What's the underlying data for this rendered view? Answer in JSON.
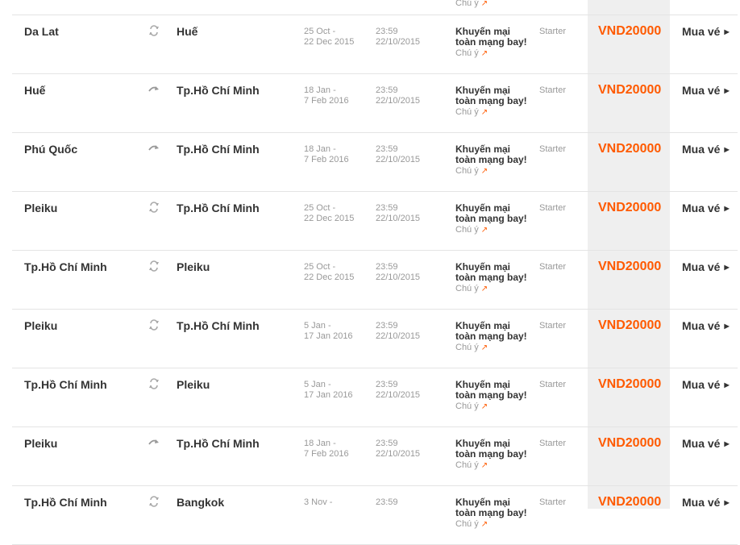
{
  "labels": {
    "note": "Chú ý",
    "buy": "Mua vé",
    "promo": "Khuyến mại toàn mạng bay!",
    "fare_class": "Starter",
    "price": "VND20000"
  },
  "icons": {
    "round_trip": "round-trip-icon",
    "one_way": "one-way-icon",
    "note_arrow": "external-arrow-icon"
  },
  "colors": {
    "accent": "#ff5a00",
    "price_band": "#efefef",
    "muted_text": "#999999",
    "main_text": "#333333"
  },
  "rows": [
    {
      "origin": "Da Lat",
      "dest": "Huế",
      "trip": "round",
      "dates": "25 Oct -\n22 Dec 2015",
      "until": "23:59\n22/10/2015"
    },
    {
      "origin": "Huế",
      "dest": "Tp.Hồ Chí Minh",
      "trip": "oneway",
      "dates": "18 Jan -\n7 Feb 2016",
      "until": "23:59\n22/10/2015"
    },
    {
      "origin": "Phú Quốc",
      "dest": "Tp.Hồ Chí Minh",
      "trip": "oneway",
      "dates": "18 Jan -\n7 Feb 2016",
      "until": "23:59\n22/10/2015"
    },
    {
      "origin": "Pleiku",
      "dest": "Tp.Hồ Chí Minh",
      "trip": "round",
      "dates": "25 Oct -\n22 Dec 2015",
      "until": "23:59\n22/10/2015"
    },
    {
      "origin": "Tp.Hồ Chí Minh",
      "dest": "Pleiku",
      "trip": "round",
      "dates": "25 Oct -\n22 Dec 2015",
      "until": "23:59\n22/10/2015"
    },
    {
      "origin": "Pleiku",
      "dest": "Tp.Hồ Chí Minh",
      "trip": "round",
      "dates": "5 Jan -\n17 Jan 2016",
      "until": "23:59\n22/10/2015"
    },
    {
      "origin": "Tp.Hồ Chí Minh",
      "dest": "Pleiku",
      "trip": "round",
      "dates": "5 Jan -\n17 Jan 2016",
      "until": "23:59\n22/10/2015"
    },
    {
      "origin": "Pleiku",
      "dest": "Tp.Hồ Chí Minh",
      "trip": "oneway",
      "dates": "18 Jan -\n7 Feb 2016",
      "until": "23:59\n22/10/2015"
    },
    {
      "origin": "Tp.Hồ Chí Minh",
      "dest": "Bangkok",
      "trip": "round",
      "dates": "3 Nov -",
      "until": "23:59"
    }
  ]
}
